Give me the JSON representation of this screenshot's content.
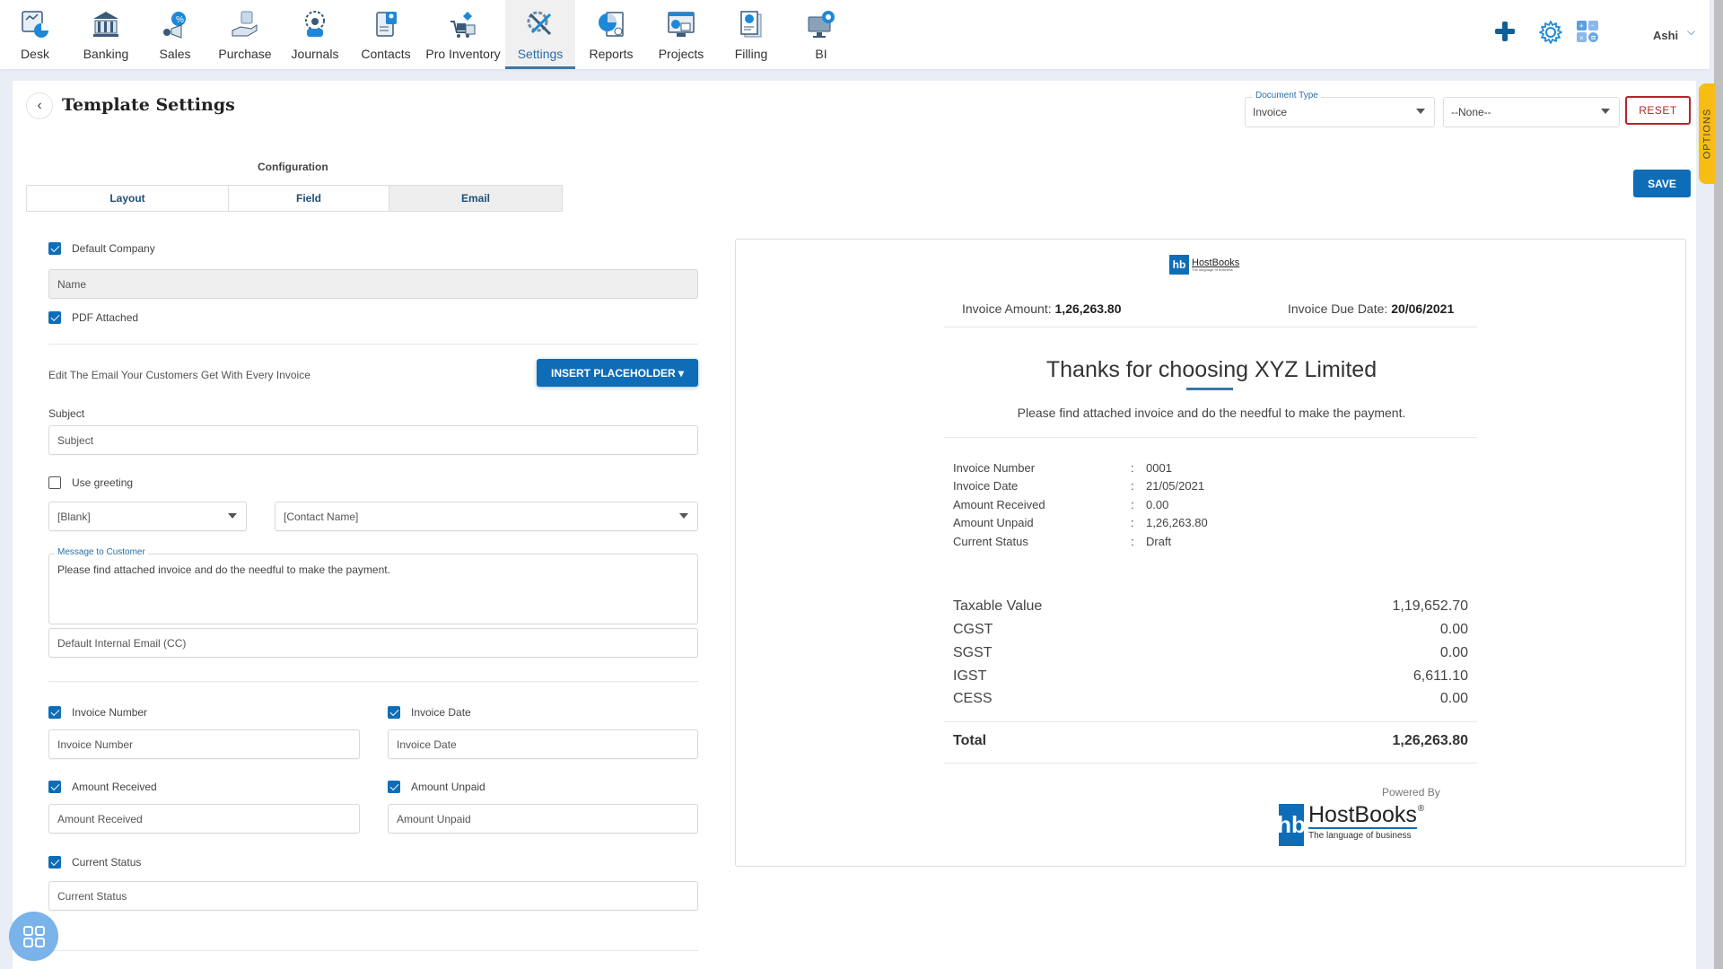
{
  "nav": {
    "items": [
      {
        "label": "Desk",
        "icon": "desk-icon"
      },
      {
        "label": "Banking",
        "icon": "bank-icon"
      },
      {
        "label": "Sales",
        "icon": "sales-icon"
      },
      {
        "label": "Purchase",
        "icon": "purchase-icon"
      },
      {
        "label": "Journals",
        "icon": "journals-icon"
      },
      {
        "label": "Contacts",
        "icon": "contacts-icon"
      },
      {
        "label": "Pro Inventory",
        "icon": "inventory-icon"
      },
      {
        "label": "Settings",
        "icon": "settings-tools-icon",
        "active": true
      },
      {
        "label": "Reports",
        "icon": "reports-icon"
      },
      {
        "label": "Projects",
        "icon": "projects-icon"
      },
      {
        "label": "Filling",
        "icon": "filling-icon"
      },
      {
        "label": "BI",
        "icon": "bi-icon"
      }
    ],
    "user_name": "Ashi",
    "right_icons": [
      "plus-icon",
      "gear-icon",
      "calculator-icon"
    ]
  },
  "colors": {
    "brand_blue": "#0f6db8",
    "reset_red": "#b3262a",
    "options_yellow": "#f7bd14"
  },
  "page": {
    "title": "Template Settings",
    "options_tab": "OPTIONS",
    "document_type": {
      "label": "Document Type",
      "value": "Invoice"
    },
    "secondary_select": "--None--",
    "reset_label": "RESET",
    "save_label": "SAVE"
  },
  "config": {
    "heading": "Configuration",
    "tabs": [
      {
        "label": "Layout"
      },
      {
        "label": "Field"
      },
      {
        "label": "Email",
        "active": true
      }
    ]
  },
  "form": {
    "default_company": {
      "label": "Default Company",
      "checked": true
    },
    "name_placeholder": "Name",
    "pdf_attached": {
      "label": "PDF Attached",
      "checked": true
    },
    "edit_email_text": "Edit The Email Your Customers Get With Every Invoice",
    "insert_placeholder_label": "INSERT PLACEHOLDER ▾",
    "subject_label": "Subject",
    "subject_placeholder": "Subject",
    "use_greeting": {
      "label": "Use greeting",
      "checked": false
    },
    "greeting_select": "[Blank]",
    "contact_select": "[Contact Name]",
    "message_label": "Message to Customer",
    "message_value": "Please find attached invoice and do the needful to make the payment.",
    "cc_placeholder": "Default Internal Email (CC)",
    "invoice_number": {
      "label": "Invoice Number",
      "checked": true,
      "placeholder": "Invoice Number"
    },
    "invoice_date": {
      "label": "Invoice Date",
      "checked": true,
      "placeholder": "Invoice Date"
    },
    "amount_received": {
      "label": "Amount Received",
      "checked": true,
      "placeholder": "Amount Received"
    },
    "amount_unpaid": {
      "label": "Amount Unpaid",
      "checked": true,
      "placeholder": "Amount Unpaid"
    },
    "current_status": {
      "label": "Current Status",
      "checked": true,
      "placeholder": "Current Status"
    }
  },
  "preview": {
    "logo_text": "HostBooks",
    "logo_tagline": "The language of business",
    "invoice_amount_label": "Invoice Amount:",
    "invoice_amount_value": "1,26,263.80",
    "due_date_label": "Invoice Due Date:",
    "due_date_value": "20/06/2021",
    "thanks_title": "Thanks for choosing XYZ Limited",
    "thanks_message": "Please find attached invoice and do the needful to make the payment.",
    "details": [
      {
        "key": "Invoice Number",
        "value": "0001"
      },
      {
        "key": "Invoice Date",
        "value": "21/05/2021"
      },
      {
        "key": "Amount Received",
        "value": "0.00"
      },
      {
        "key": "Amount Unpaid",
        "value": "1,26,263.80"
      },
      {
        "key": "Current Status",
        "value": "Draft"
      }
    ],
    "summary": [
      {
        "key": "Taxable Value",
        "value": "1,19,652.70"
      },
      {
        "key": "CGST",
        "value": "0.00"
      },
      {
        "key": "SGST",
        "value": "0.00"
      },
      {
        "key": "IGST",
        "value": "6,611.10"
      },
      {
        "key": "CESS",
        "value": "0.00"
      }
    ],
    "total_label": "Total",
    "total_value": "1,26,263.80",
    "powered_by": "Powered By"
  }
}
